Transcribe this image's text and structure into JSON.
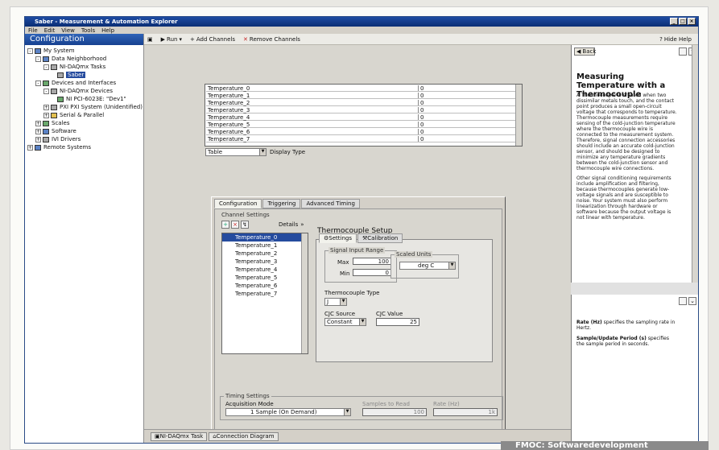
{
  "window": {
    "title": "Saber - Measurement & Automation Explorer",
    "controls": {
      "min": "_",
      "max": "□",
      "close": "×"
    }
  },
  "menu": [
    "File",
    "Edit",
    "View",
    "Tools",
    "Help"
  ],
  "toolbar": {
    "run": "Run",
    "add": "Add Channels",
    "remove": "Remove Channels",
    "hide": "Hide Help"
  },
  "left": {
    "header": "Configuration",
    "tree": [
      {
        "label": "My System",
        "indent": 0,
        "pm": "-",
        "icon": "computer-icon"
      },
      {
        "label": "Data Neighborhood",
        "indent": 1,
        "pm": "-",
        "icon": "folder-icon"
      },
      {
        "label": "NI-DAQmx Tasks",
        "indent": 2,
        "pm": "-",
        "icon": "task-icon"
      },
      {
        "label": "Saber",
        "indent": 3,
        "pm": "",
        "icon": "task-file-icon",
        "selected": true
      },
      {
        "label": "Devices and Interfaces",
        "indent": 1,
        "pm": "-",
        "icon": "device-icon"
      },
      {
        "label": "NI-DAQmx Devices",
        "indent": 2,
        "pm": "-",
        "icon": "daq-icon"
      },
      {
        "label": "NI PCI-6023E: \"Dev1\"",
        "indent": 3,
        "pm": "",
        "icon": "board-icon"
      },
      {
        "label": "PXI PXI System (Unidentified)",
        "indent": 2,
        "pm": "+",
        "icon": "pxi-icon"
      },
      {
        "label": "Serial & Parallel",
        "indent": 2,
        "pm": "+",
        "icon": "serial-icon"
      },
      {
        "label": "Scales",
        "indent": 1,
        "pm": "+",
        "icon": "scale-icon"
      },
      {
        "label": "Software",
        "indent": 1,
        "pm": "+",
        "icon": "software-icon"
      },
      {
        "label": "IVI Drivers",
        "indent": 1,
        "pm": "+",
        "icon": "ivi-icon"
      },
      {
        "label": "Remote Systems",
        "indent": 0,
        "pm": "+",
        "icon": "remote-icon"
      }
    ]
  },
  "grid": {
    "rows": [
      {
        "name": "Temperature_0",
        "value": "0"
      },
      {
        "name": "Temperature_1",
        "value": "0"
      },
      {
        "name": "Temperature_2",
        "value": "0"
      },
      {
        "name": "Temperature_3",
        "value": "0"
      },
      {
        "name": "Temperature_4",
        "value": "0"
      },
      {
        "name": "Temperature_5",
        "value": "0"
      },
      {
        "name": "Temperature_6",
        "value": "0"
      },
      {
        "name": "Temperature_7",
        "value": "0"
      }
    ],
    "display_type": "Table",
    "display_type_label": "Display Type"
  },
  "config": {
    "tabs": [
      "Configuration",
      "Triggering",
      "Advanced Timing"
    ],
    "channel_settings": "Channel Settings",
    "details": "Details",
    "channels": [
      "Temperature_0",
      "Temperature_1",
      "Temperature_2",
      "Temperature_3",
      "Temperature_4",
      "Temperature_5",
      "Temperature_6",
      "Temperature_7"
    ],
    "setup_title": "Thermocouple Setup",
    "subtabs": [
      "Settings",
      "Calibration"
    ],
    "signal_input_range": "Signal Input Range",
    "max_label": "Max",
    "max_value": "100",
    "min_label": "Min",
    "min_value": "0",
    "scaled_units": "Scaled Units",
    "units_value": "deg C",
    "thermocouple_type": "Thermocouple Type",
    "type_value": "J",
    "cjc_source": "CJC Source",
    "cjc_source_value": "Constant",
    "cjc_value": "CJC Value",
    "cjc_value_value": "25",
    "timing_settings": "Timing Settings",
    "acquisition_mode": "Acquisition Mode",
    "acquisition_value": "1 Sample (On Demand)",
    "samples_label": "Samples to Read",
    "samples_value": "100",
    "rate_label": "Rate (Hz)",
    "rate_value": "1k"
  },
  "bottom_tabs": [
    "NI-DAQmx Task",
    "Connection Diagram"
  ],
  "help": {
    "back": "Back",
    "title": "Measuring Temperature with a Thermocouple",
    "para1": "A Thermocouple is created when two dissimilar metals touch, and the contact point produces a small open-circuit voltage that corresponds to temperature. Thermocouple measurements require sensing of the cold-junction temperature where the thermocouple wire is connected to the measurement system. Therefore, signal connection accessories should include an accurate cold-junction sensor, and should be designed to minimize any temperature gradients between the cold-junction sensor and thermocouple wire connections.",
    "para2": "Other signal conditioning requirements include amplification and filtering, because thermocouples generate low-voltage signals and are susceptible to noise. Your system must also perform linearization through hardware or software because the output voltage is not linear with temperature.",
    "rate_title": "Rate (Hz)",
    "rate_text": "specifies the sampling rate in Hertz.",
    "sample_title": "Sample/Update Period (s)",
    "sample_text": "specifies the sample period in seconds."
  },
  "footer": "FMOC: Softwaredevelopment"
}
